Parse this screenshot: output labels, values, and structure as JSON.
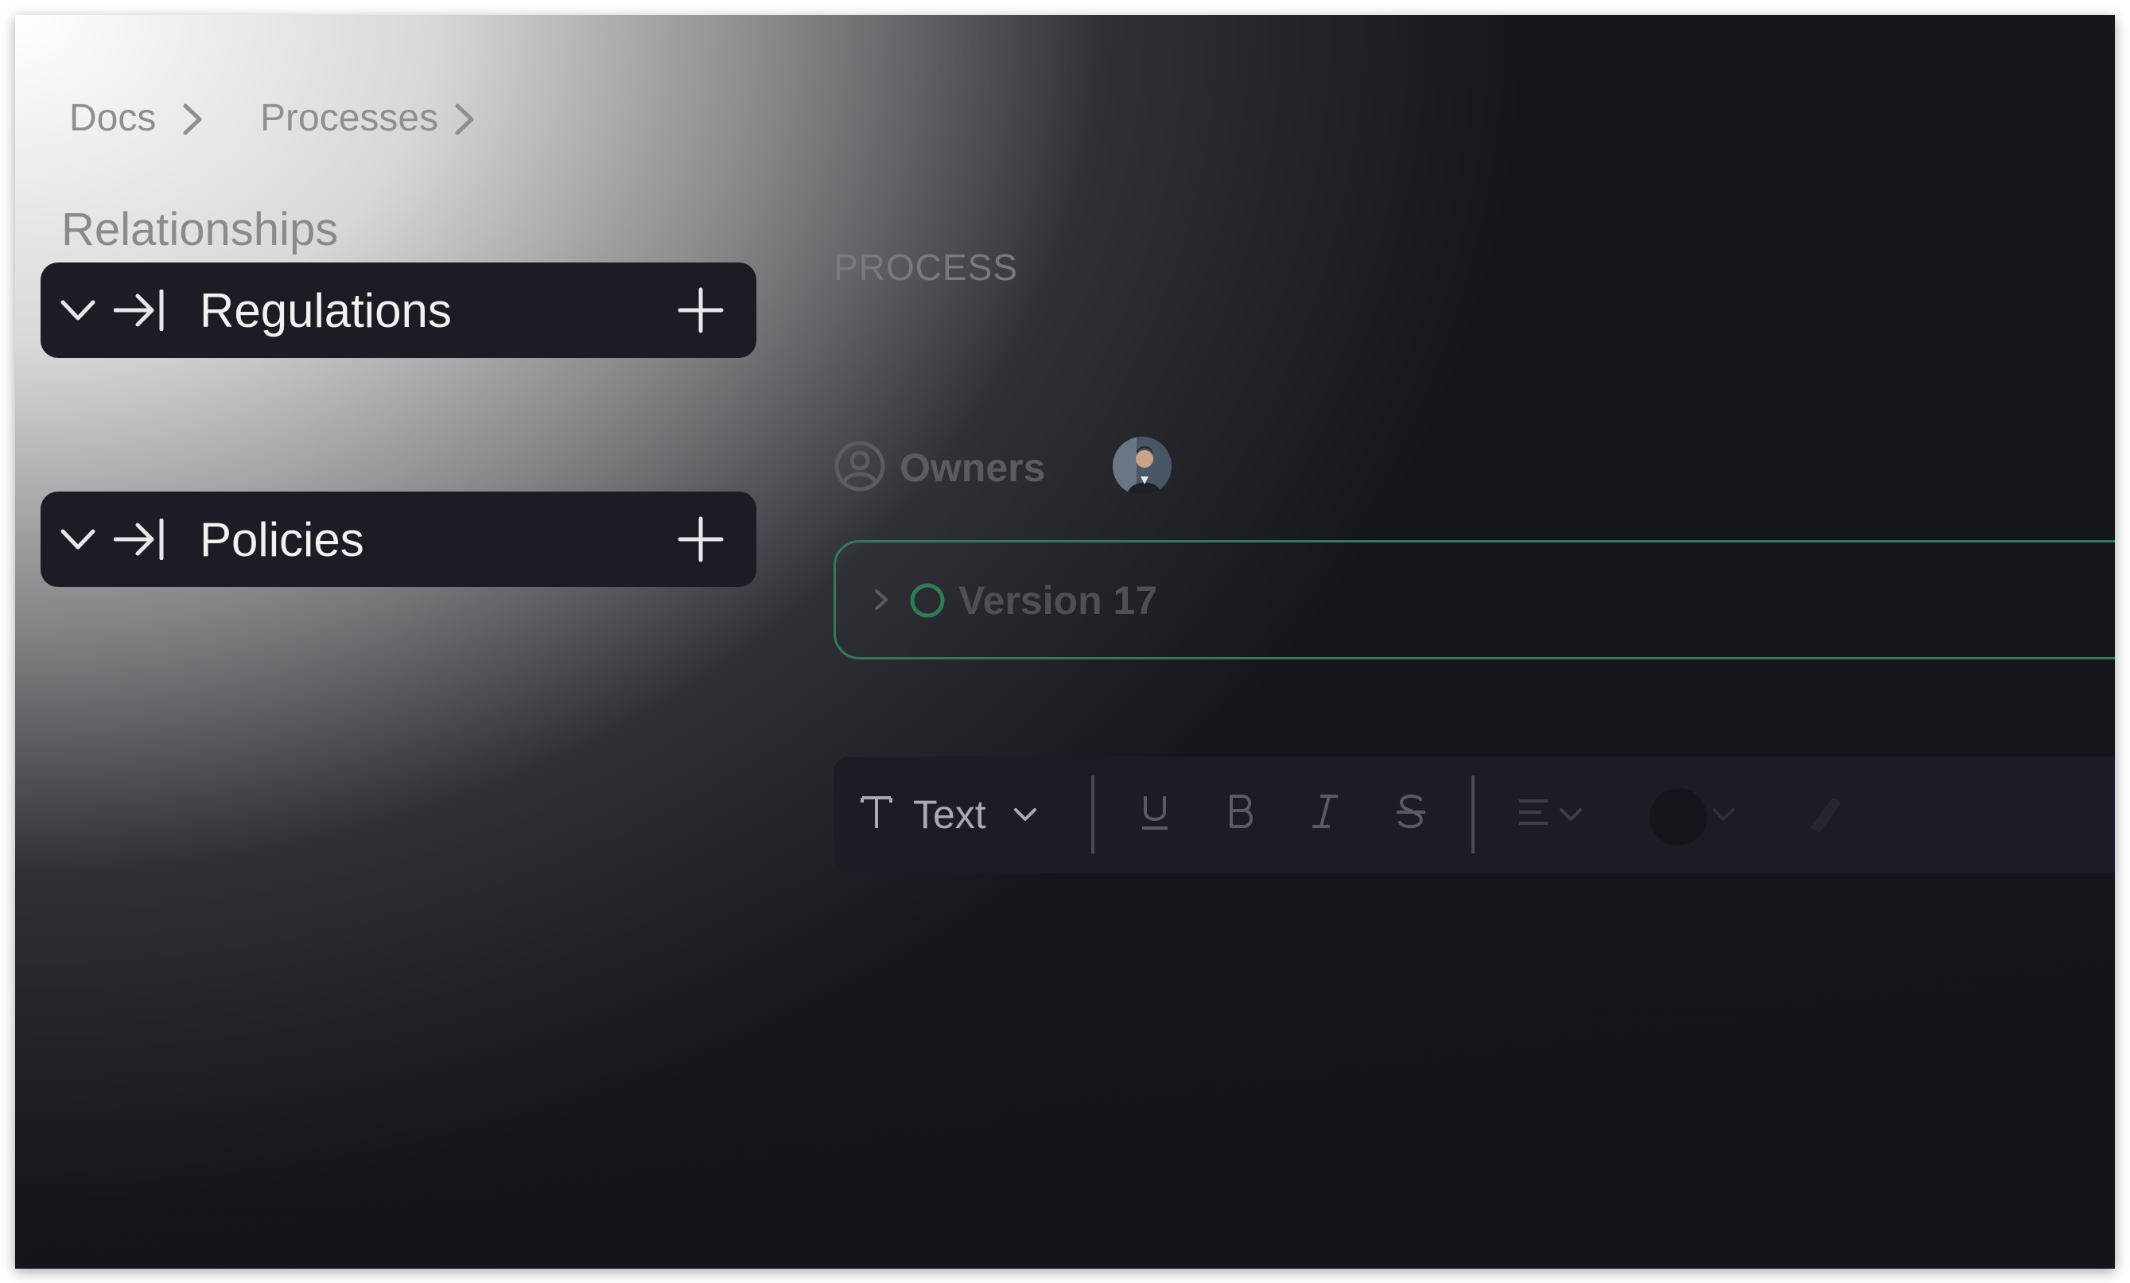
{
  "breadcrumb": {
    "items": [
      {
        "label": "Docs"
      },
      {
        "label": "Processes"
      }
    ]
  },
  "relationships": {
    "title": "Relationships",
    "groups": [
      {
        "label": "Regulations"
      },
      {
        "label": "Policies"
      }
    ]
  },
  "process": {
    "section_label": "PROCESS",
    "owners_label": "Owners",
    "version_label": "Version 17"
  },
  "toolbar": {
    "block_type": "Text",
    "buttons": [
      "underline",
      "bold",
      "italic",
      "strikethrough",
      "align",
      "text-color",
      "highlight"
    ]
  },
  "colors": {
    "bar_bg": "#1c1d24",
    "accent_green": "#2e7d54",
    "icon_light": "#e8e8ec",
    "icon_muted": "#5a5b62"
  }
}
